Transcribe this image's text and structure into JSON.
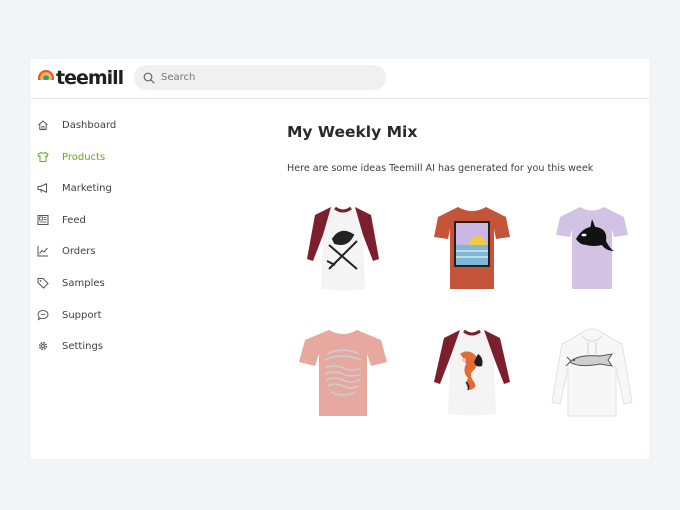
{
  "brand": {
    "name": "teemill",
    "accent": "#67a91b"
  },
  "search": {
    "placeholder": "Search"
  },
  "sidebar": {
    "items": [
      {
        "label": "Dashboard",
        "icon": "home-icon",
        "active": false
      },
      {
        "label": "Products",
        "icon": "tshirt-icon",
        "active": true
      },
      {
        "label": "Marketing",
        "icon": "megaphone-icon",
        "active": false
      },
      {
        "label": "Feed",
        "icon": "newspaper-icon",
        "active": false
      },
      {
        "label": "Orders",
        "icon": "chart-line-icon",
        "active": false
      },
      {
        "label": "Samples",
        "icon": "tag-icon",
        "active": false
      },
      {
        "label": "Support",
        "icon": "chat-icon",
        "active": false
      },
      {
        "label": "Settings",
        "icon": "gear-icon",
        "active": false
      }
    ]
  },
  "main": {
    "title": "My Weekly Mix",
    "subtitle": "Here are some ideas Teemill AI has generated for you this week",
    "products": [
      {
        "garment": "raglan-tee",
        "body_color": "#f4f4f4",
        "sleeve_color": "#7a1f2b",
        "design": "fishing-rod-and-fish illustration"
      },
      {
        "garment": "tee",
        "body_color": "#c4553a",
        "design": "sunset over sea"
      },
      {
        "garment": "tee",
        "body_color": "#d2c2e3",
        "design": "orca"
      },
      {
        "garment": "tee",
        "body_color": "#e7a99f",
        "design": "wave pattern"
      },
      {
        "garment": "raglan-tee",
        "body_color": "#f4f4f4",
        "sleeve_color": "#7a1f2b",
        "design": "koi fish"
      },
      {
        "garment": "hoodie",
        "body_color": "#f7f7f7",
        "design": "catfish sketch"
      }
    ]
  }
}
